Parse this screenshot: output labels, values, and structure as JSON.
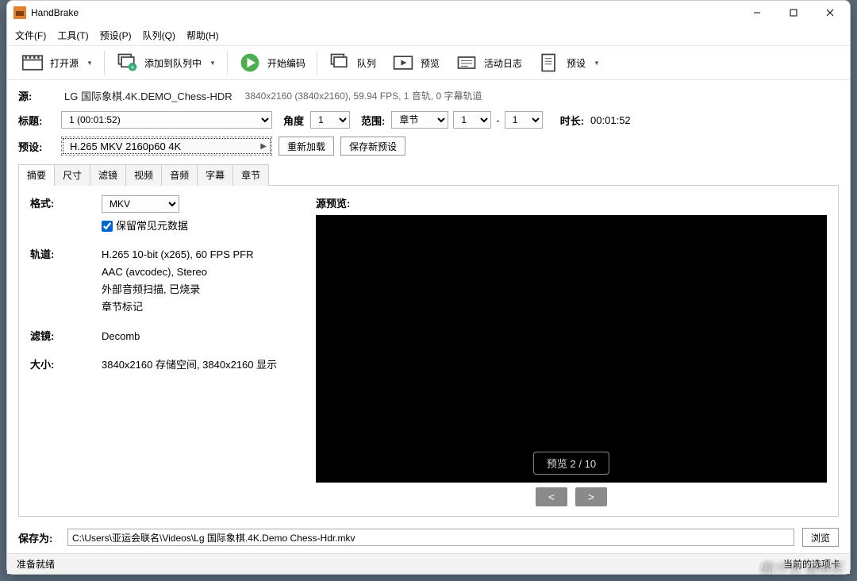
{
  "window": {
    "title": "HandBrake"
  },
  "menubar": [
    "文件(F)",
    "工具(T)",
    "预设(P)",
    "队列(Q)",
    "帮助(H)"
  ],
  "toolbar": {
    "open": "打开源",
    "addqueue": "添加到队列中",
    "start": "开始编码",
    "queue": "队列",
    "preview": "预览",
    "log": "活动日志",
    "presets": "预设"
  },
  "source": {
    "label": "源:",
    "name": "LG 国际象棋.4K.DEMO_Chess-HDR",
    "info": "3840x2160 (3840x2160), 59.94 FPS, 1 音轨, 0 字幕轨道"
  },
  "titleRow": {
    "titleLabel": "标题:",
    "titleValue": "1  (00:01:52)",
    "angleLabel": "角度",
    "angleValue": "1",
    "rangeLabel": "范围:",
    "rangeValue": "章节",
    "rangeFrom": "1",
    "rangeDash": "-",
    "rangeTo": "1",
    "durationLabel": "时长:",
    "durationValue": "00:01:52"
  },
  "presetRow": {
    "label": "预设:",
    "value": "H.265 MKV 2160p60 4K",
    "reload": "重新加载",
    "savenew": "保存新预设"
  },
  "tabs": [
    "摘要",
    "尺寸",
    "滤镜",
    "视频",
    "音频",
    "字幕",
    "章节"
  ],
  "summary": {
    "formatLabel": "格式:",
    "formatValue": "MKV",
    "keepMeta": "保留常见元数据",
    "tracksLabel": "轨道:",
    "track1": "H.265 10-bit (x265), 60 FPS PFR",
    "track2": "AAC (avcodec), Stereo",
    "track3": "外部音频扫描, 已烧录",
    "track4": "章节标记",
    "filtersLabel": "滤镜:",
    "filtersValue": "Decomb",
    "sizeLabel": "大小:",
    "sizeValue": "3840x2160 存储空间, 3840x2160 显示"
  },
  "preview": {
    "label": "源预览:",
    "counter": "预览 2 / 10",
    "prev": "<",
    "next": ">"
  },
  "save": {
    "label": "保存为:",
    "path": "C:\\Users\\亚运会联名\\Videos\\Lg 国际象棋.4K.Demo Chess-Hdr.mkv",
    "browse": "浏览"
  },
  "status": {
    "text": "准备就绪",
    "right": "当前的选项卡"
  },
  "watermark": "值(什么 值得买"
}
